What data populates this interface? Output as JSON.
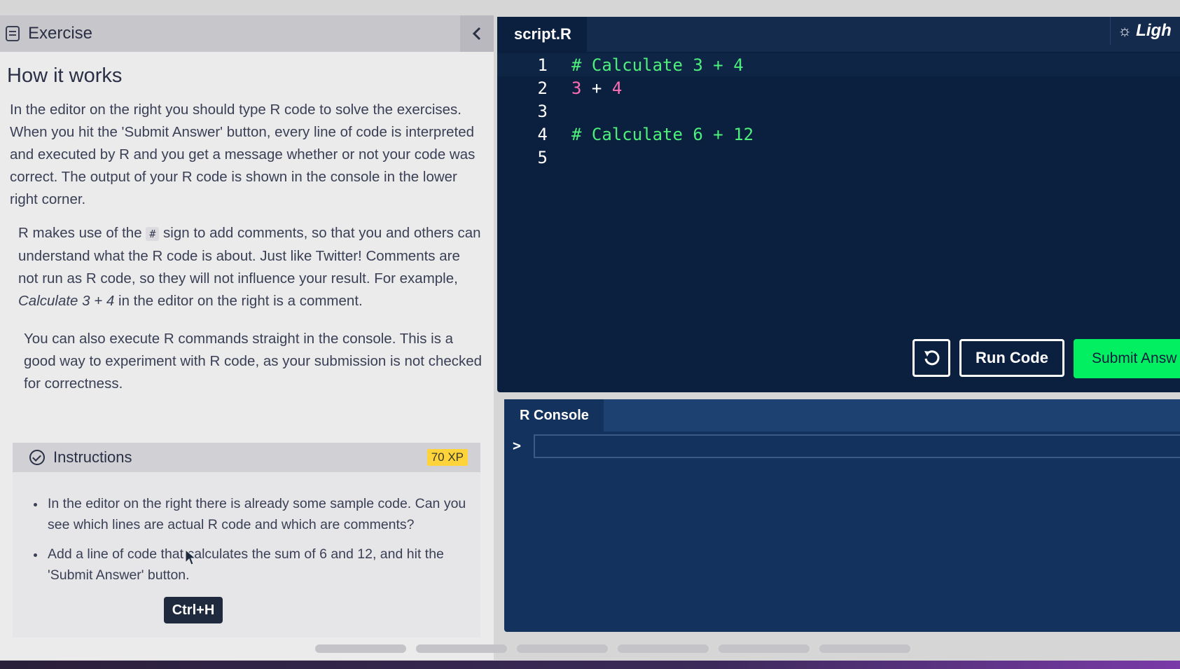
{
  "exercise_panel": {
    "title": "Exercise",
    "collapse_icon": "chevron-left-icon",
    "heading": "How it works",
    "para1": "In the editor on the right you should type R code to solve the exercises. When you hit the 'Submit Answer' button, every line of code is interpreted and executed by R and you get a message whether or not your code was correct. The output of your R code is shown in the console in the lower right corner.",
    "para2_a": "R makes use of the ",
    "para2_code": "#",
    "para2_b": " sign to add comments, so that you and others can understand what the R code is about. Just like Twitter! Comments are not run as R code, so they will not influence your result. For example, ",
    "para2_em": "Calculate 3 + 4",
    "para2_c": " in the editor on the right is a comment.",
    "para3": "You can also execute R commands straight in the console. This is a good way to experiment with R code, as your submission is not checked for correctness."
  },
  "instructions": {
    "label": "Instructions",
    "xp": "70 XP",
    "items": [
      "In the editor on the right there is already some sample code. Can you see which lines are actual R code and which are comments?",
      "Add a line of code that calculates the sum of 6 and 12, and hit the 'Submit Answer' button."
    ],
    "tooltip": "Ctrl+H"
  },
  "editor": {
    "tab": "script.R",
    "theme_label": "Ligh",
    "line_numbers": [
      "1",
      "2",
      "3",
      "4",
      "5"
    ],
    "lines": {
      "l1": "# Calculate 3 + 4",
      "l2_num1": "3",
      "l2_op": " + ",
      "l2_num2": "4",
      "l3": "",
      "l4": "# Calculate 6 + 12",
      "l5": ""
    },
    "run_label": "Run Code",
    "submit_label": "Submit Answ"
  },
  "console": {
    "tab": "R Console",
    "prompt": ">"
  },
  "colors": {
    "editor_bg": "#0b1f3f",
    "console_bg": "#13335e",
    "comment": "#4cf07a",
    "number": "#ff6eb4",
    "submit": "#03ef62",
    "xp_badge": "#ffd43b"
  }
}
